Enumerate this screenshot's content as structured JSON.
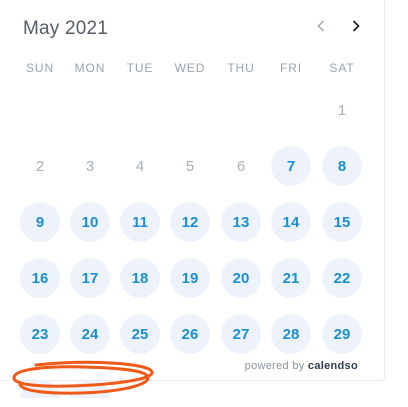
{
  "calendar": {
    "month_label": "May 2021",
    "prev_icon": "chevron-left-icon",
    "next_icon": "chevron-right-icon",
    "weekdays": [
      "SUN",
      "MON",
      "TUE",
      "WED",
      "THU",
      "FRI",
      "SAT"
    ],
    "rows": [
      [
        null,
        null,
        null,
        null,
        null,
        null,
        {
          "label": "1",
          "available": false
        }
      ],
      [
        {
          "label": "2",
          "available": false
        },
        {
          "label": "3",
          "available": false
        },
        {
          "label": "4",
          "available": false
        },
        {
          "label": "5",
          "available": false
        },
        {
          "label": "6",
          "available": false
        },
        {
          "label": "7",
          "available": true
        },
        {
          "label": "8",
          "available": true
        }
      ],
      [
        {
          "label": "9",
          "available": true
        },
        {
          "label": "10",
          "available": true
        },
        {
          "label": "11",
          "available": true
        },
        {
          "label": "12",
          "available": true
        },
        {
          "label": "13",
          "available": true
        },
        {
          "label": "14",
          "available": true
        },
        {
          "label": "15",
          "available": true
        }
      ],
      [
        {
          "label": "16",
          "available": true
        },
        {
          "label": "17",
          "available": true
        },
        {
          "label": "18",
          "available": true
        },
        {
          "label": "19",
          "available": true
        },
        {
          "label": "20",
          "available": true
        },
        {
          "label": "21",
          "available": true
        },
        {
          "label": "22",
          "available": true
        }
      ],
      [
        {
          "label": "23",
          "available": true
        },
        {
          "label": "24",
          "available": true
        },
        {
          "label": "25",
          "available": true
        },
        {
          "label": "26",
          "available": true
        },
        {
          "label": "27",
          "available": true
        },
        {
          "label": "28",
          "available": true
        },
        {
          "label": "29",
          "available": true
        }
      ],
      [
        {
          "label": "",
          "available": true,
          "partial": true
        },
        {
          "label": "",
          "available": true,
          "partial": true
        },
        null,
        null,
        null,
        null,
        null
      ]
    ]
  },
  "footer": {
    "prefix": "powered by",
    "brand": "calendso"
  },
  "colors": {
    "accent": "#1a8fd1",
    "available_bg": "#eef3fb",
    "muted_text": "#a9b0b8",
    "annotation": "#f05a18"
  }
}
